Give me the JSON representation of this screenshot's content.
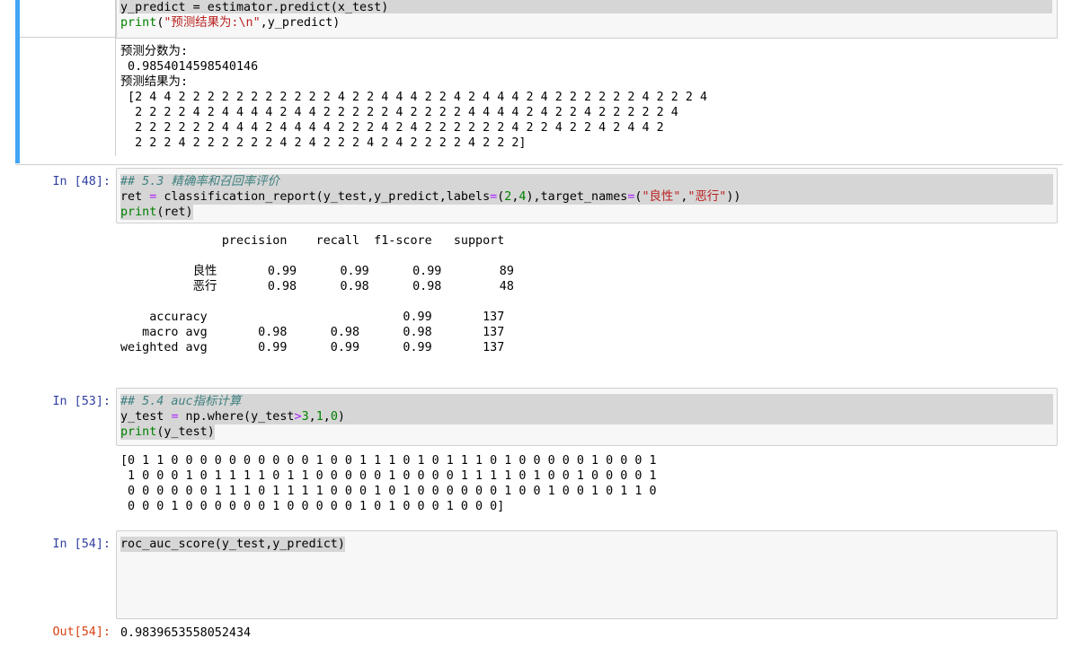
{
  "cells": {
    "top": {
      "code_line1": "y_predict = estimator.predict(x_test)",
      "code_line2_fn": "print",
      "code_line2_str": "\"预测结果为:\\n\"",
      "code_line2_rest": ",y_predict)",
      "code_line2_open": "(",
      "output_line1": "预测分数为:",
      "output_line2": " 0.9854014598540146",
      "output_line3": "预测结果为:",
      "output_line4": " [2 4 4 2 2 2 2 2 2 2 2 2 2 2 4 2 2 4 4 4 2 2 4 2 4 4 4 2 4 2 2 2 2 2 2 4 2 2 2 4",
      "output_line5": "  2 2 2 2 4 2 4 4 4 4 2 4 4 2 2 2 2 2 4 2 2 2 2 4 4 4 4 2 4 2 2 4 2 2 2 2 2 4",
      "output_line6": "  2 2 2 2 2 2 4 4 4 2 4 4 4 4 2 2 2 4 2 4 2 2 2 2 2 2 4 2 2 4 2 2 4 2 4 4 2",
      "output_line7": "  2 2 2 4 2 2 2 2 2 2 4 2 4 2 2 2 4 2 4 2 2 2 2 4 2 2 2]"
    },
    "cell48": {
      "prompt": "In [48]:",
      "comment": "## 5.3 精确率和召回率评价",
      "line2_a": "ret ",
      "line2_eq": "=",
      "line2_b": " classification_report(y_test,y_predict,labels",
      "line2_eq2": "=",
      "line2_c": "(",
      "line2_n1": "2",
      "line2_d": ",",
      "line2_n2": "4",
      "line2_e": "),target_names",
      "line2_eq3": "=",
      "line2_f": "(",
      "line2_s1": "\"良性\"",
      "line2_g": ",",
      "line2_s2": "\"恶行\"",
      "line2_h": "))",
      "line3_fn": "print",
      "line3_rest": "(ret)",
      "report": {
        "header": "              precision    recall  f1-score   support",
        "row1": "          良性       0.99      0.99      0.99        89",
        "row2": "          恶行       0.98      0.98      0.98        48",
        "row3": "    accuracy                           0.99       137",
        "row4": "   macro avg       0.98      0.98      0.98       137",
        "row5": "weighted avg       0.99      0.99      0.99       137"
      }
    },
    "cell53": {
      "prompt": "In [53]:",
      "comment": "## 5.4 auc指标计算",
      "line2_a": "y_test ",
      "line2_eq": "=",
      "line2_b": " np.where(y_test",
      "line2_gt": ">",
      "line2_n1": "3",
      "line2_c": ",",
      "line2_n2": "1",
      "line2_d": ",",
      "line2_n3": "0",
      "line2_e": ")",
      "line3_fn": "print",
      "line3_rest": "(y_test)",
      "output_line1": "[0 1 1 0 0 0 0 0 0 0 0 0 0 1 0 0 1 1 1 0 1 0 1 1 1 0 1 0 0 0 0 0 1 0 0 0 1",
      "output_line2": " 1 0 0 0 1 0 1 1 1 1 0 1 1 0 0 0 0 0 1 0 0 0 0 1 1 1 1 0 1 0 0 1 0 0 0 0 1",
      "output_line3": " 0 0 0 0 0 0 1 1 1 0 1 1 1 1 0 0 0 1 0 1 0 0 0 0 0 0 1 0 0 1 0 0 1 0 1 1 0",
      "output_line4": " 0 0 0 1 0 0 0 0 0 0 1 0 0 0 0 0 1 0 1 0 0 0 1 0 0 0]"
    },
    "cell54": {
      "prompt": "In [54]:",
      "code": "roc_auc_score(y_test,y_predict)",
      "out_prompt": "Out[54]:",
      "output": "0.9839653558052434"
    }
  },
  "colors": {
    "selected_bar": "#42a5f5",
    "prompt_in": "#303f9f",
    "prompt_out": "#d84315",
    "comment": "#408080",
    "builtin": "#008000",
    "string": "#ba2121",
    "operator": "#aa22ff"
  }
}
